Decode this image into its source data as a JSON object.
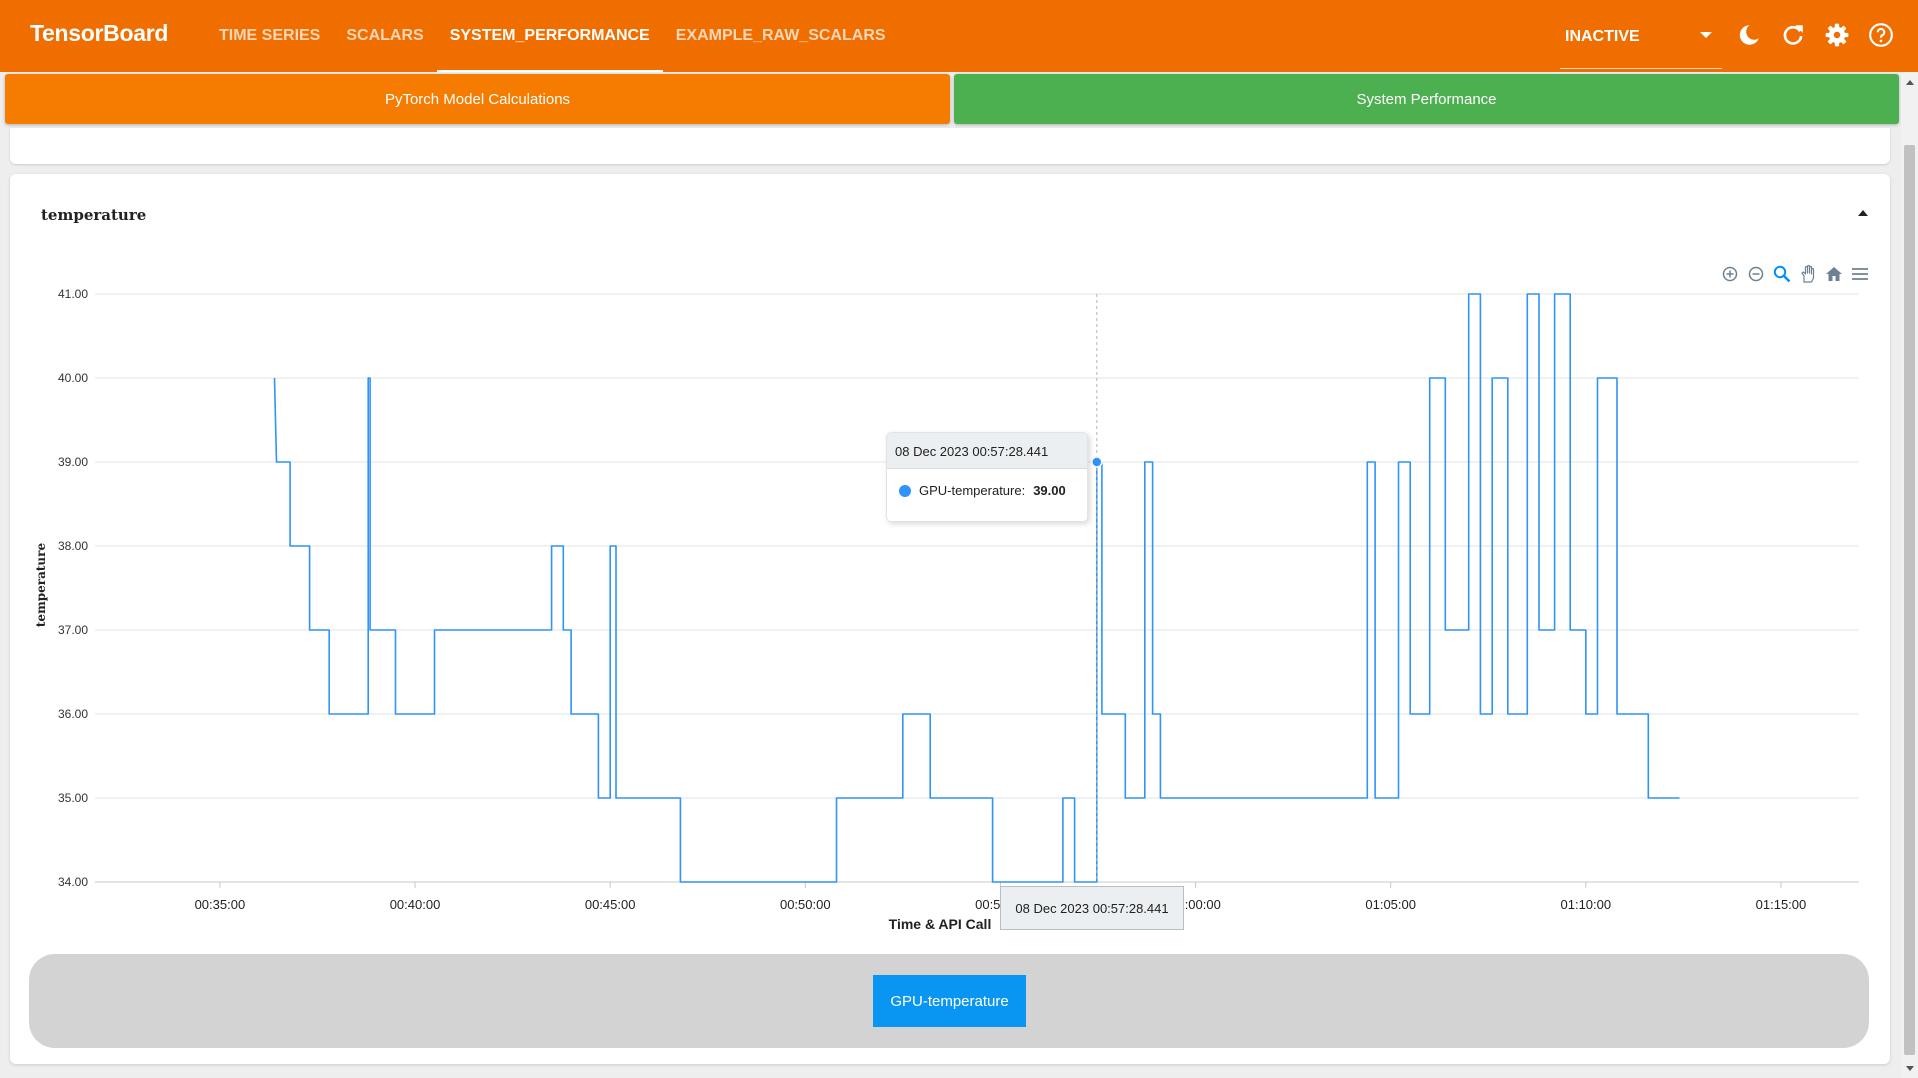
{
  "header": {
    "brand": "TensorBoard",
    "tabs": [
      {
        "label": "TIME SERIES",
        "active": false
      },
      {
        "label": "SCALARS",
        "active": false
      },
      {
        "label": "SYSTEM_PERFORMANCE",
        "active": true
      },
      {
        "label": "EXAMPLE_RAW_SCALARS",
        "active": false
      }
    ],
    "run_select": "INACTIVE",
    "icons": [
      "dark-mode-icon",
      "refresh-icon",
      "settings-icon",
      "help-icon"
    ]
  },
  "subtabs": [
    {
      "label": "PyTorch Model Calculations",
      "color": "#f57c00"
    },
    {
      "label": "System Performance",
      "color": "#4caf50"
    }
  ],
  "card": {
    "title": "temperature",
    "toolbar": [
      "zoom-in-icon",
      "zoom-out-icon",
      "selection-zoom-icon",
      "pan-icon",
      "reset-home-icon",
      "menu-icon"
    ]
  },
  "tooltip": {
    "timestamp": "08 Dec 2023 00:57:28.441",
    "series": "GPU-temperature:",
    "value": "39.00"
  },
  "x_tooltip": "08 Dec 2023 00:57:28.441",
  "legend": {
    "label": "GPU-temperature",
    "color": "#0996f2"
  },
  "chart_data": {
    "type": "line",
    "title": "temperature",
    "xlabel": "Time & API Call",
    "ylabel": "temperature",
    "x_tick_labels": [
      "00:35:00",
      "00:40:00",
      "00:45:00",
      "00:50:00",
      "00:55:00",
      "01:00:00",
      "01:05:00",
      "01:10:00",
      "01:15:00"
    ],
    "y_tick_labels": [
      "34.00",
      "35.00",
      "36.00",
      "37.00",
      "38.00",
      "39.00",
      "40.00",
      "41.00"
    ],
    "ylim": [
      34,
      41
    ],
    "xlim_minutes": [
      31.8,
      77.0
    ],
    "grid": true,
    "series": [
      {
        "name": "GPU-temperature",
        "color": "#2e93fa",
        "x_minutes": [
          36.4,
          36.45,
          36.8,
          36.8,
          37.3,
          37.3,
          37.8,
          37.8,
          38.8,
          38.8,
          38.85,
          38.85,
          39.5,
          39.5,
          40.5,
          40.5,
          41.5,
          41.5,
          43.5,
          43.5,
          43.8,
          43.8,
          44.0,
          44.0,
          44.7,
          44.7,
          45.0,
          45.0,
          45.15,
          45.15,
          46.8,
          46.8,
          50.8,
          50.8,
          52.5,
          52.5,
          53.2,
          53.2,
          54.8,
          54.8,
          56.6,
          56.6,
          56.9,
          56.9,
          57.47,
          57.47,
          57.6,
          57.6,
          58.2,
          58.2,
          58.7,
          58.7,
          58.9,
          58.9,
          59.1,
          59.1,
          59.8,
          59.8,
          64.4,
          64.4,
          64.6,
          64.6,
          65.2,
          65.2,
          65.5,
          65.5,
          66.0,
          66.0,
          66.4,
          66.4,
          67.0,
          67.0,
          67.3,
          67.3,
          67.6,
          67.6,
          68.0,
          68.0,
          68.5,
          68.5,
          68.8,
          68.8,
          69.2,
          69.2,
          69.6,
          69.6,
          70.0,
          70.0,
          70.3,
          70.3,
          70.8,
          70.8,
          71.1,
          71.1,
          71.6,
          71.6,
          72.4
        ],
        "values": [
          40,
          39,
          39,
          38,
          38,
          37,
          37,
          36,
          36,
          40,
          40,
          37,
          37,
          36,
          36,
          37,
          37,
          37,
          37,
          38,
          38,
          37,
          37,
          36,
          36,
          35,
          35,
          38,
          38,
          35,
          35,
          34,
          34,
          35,
          35,
          36,
          36,
          35,
          35,
          34,
          34,
          35,
          35,
          34,
          34,
          39,
          39,
          36,
          36,
          35,
          35,
          39,
          39,
          36,
          36,
          35,
          35,
          35,
          35,
          39,
          39,
          35,
          35,
          39,
          39,
          36,
          36,
          40,
          40,
          37,
          37,
          41,
          41,
          36,
          36,
          40,
          40,
          36,
          36,
          41,
          41,
          37,
          37,
          41,
          41,
          37,
          37,
          36,
          36,
          40,
          40,
          36,
          36,
          36,
          36,
          35,
          35
        ]
      }
    ]
  }
}
